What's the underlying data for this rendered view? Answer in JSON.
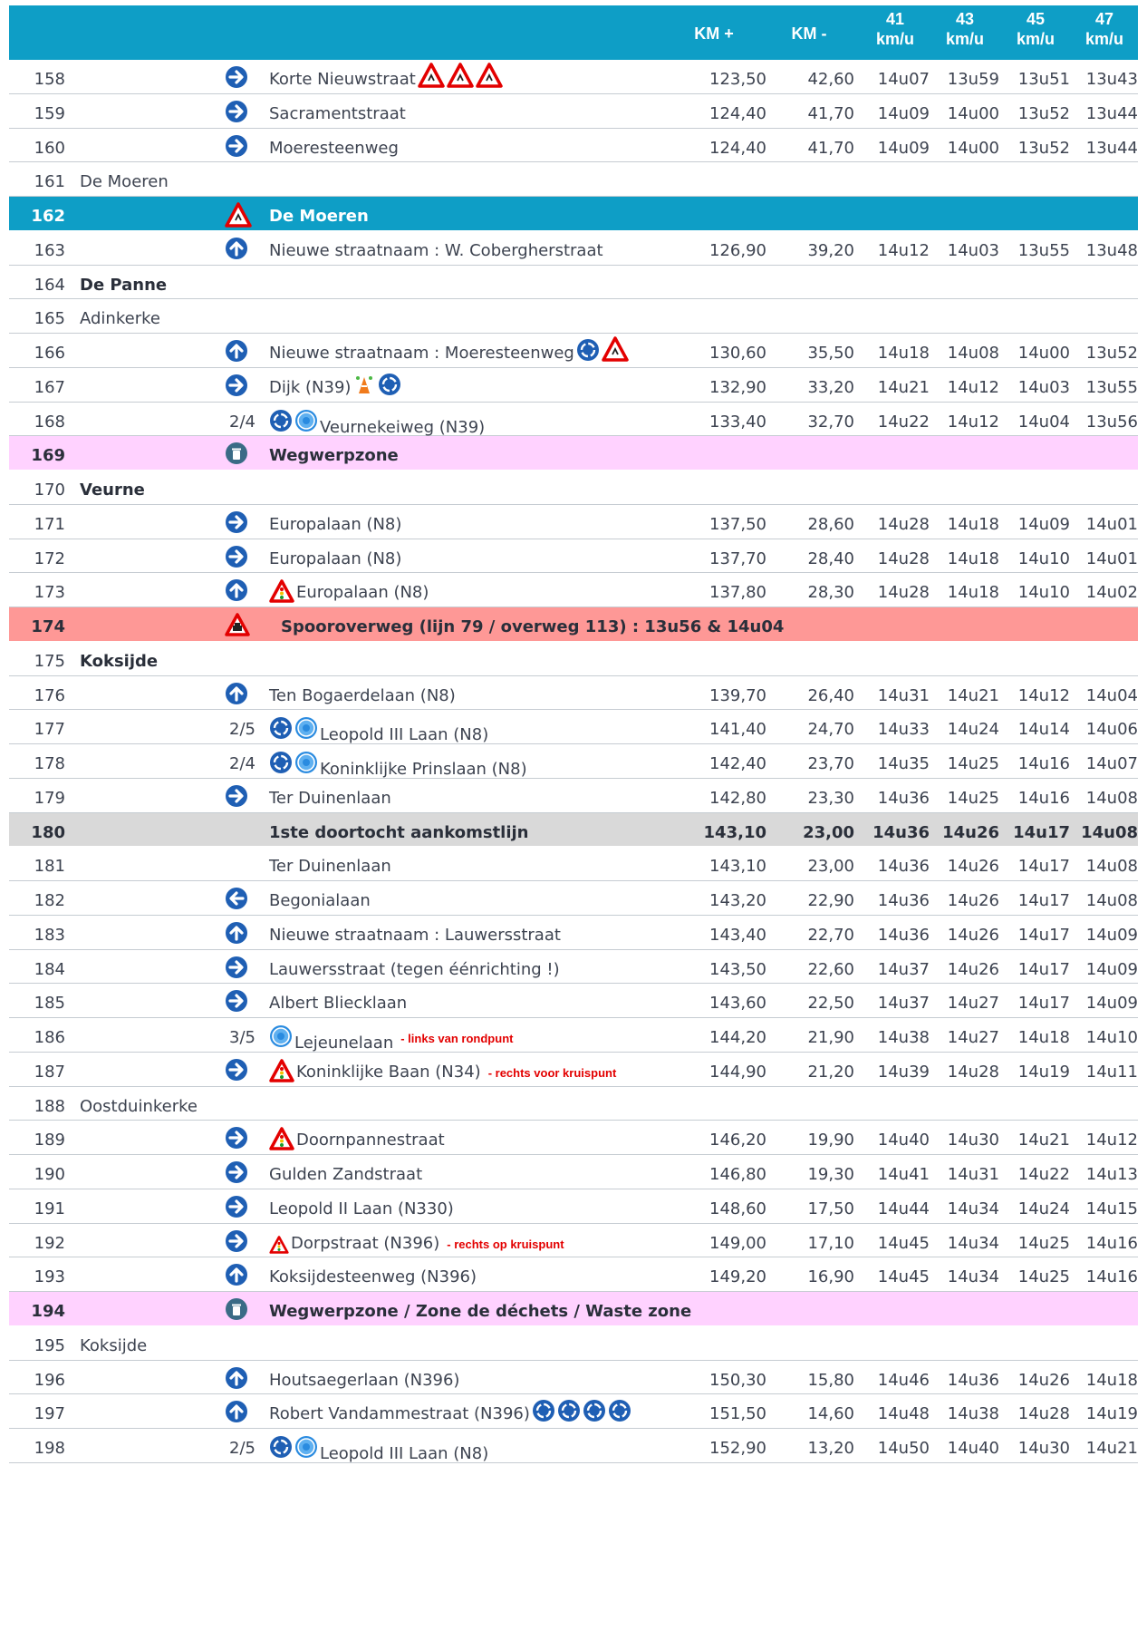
{
  "header": {
    "km_plus": "KM +",
    "km_minus": "KM -",
    "speeds": [
      {
        "top": "41",
        "bottom": "km/u"
      },
      {
        "top": "43",
        "bottom": "km/u"
      },
      {
        "top": "45",
        "bottom": "km/u"
      },
      {
        "top": "47",
        "bottom": "km/u"
      }
    ]
  },
  "colors": {
    "header": "#0e9ec6",
    "waste_zone": "#ffd2ff",
    "railway": "#fe9896",
    "finish": "#d9d9d9",
    "arrow": "#1f5fb4"
  },
  "rows": [
    {
      "num": "158",
      "kind": "route",
      "dir": "right",
      "street": "Korte Nieuwstraat",
      "signs": [
        "warning",
        "warning",
        "warning"
      ],
      "km_plus": "123,50",
      "km_minus": "42,60",
      "times": [
        "14u07",
        "13u59",
        "13u51",
        "13u43"
      ]
    },
    {
      "num": "159",
      "kind": "route",
      "dir": "right",
      "street": "Sacramentstraat",
      "km_plus": "124,40",
      "km_minus": "41,70",
      "times": [
        "14u09",
        "14u00",
        "13u52",
        "13u44"
      ]
    },
    {
      "num": "160",
      "kind": "route",
      "dir": "right",
      "street": "Moeresteenweg",
      "km_plus": "124,40",
      "km_minus": "41,70",
      "times": [
        "14u09",
        "14u00",
        "13u52",
        "13u44"
      ]
    },
    {
      "num": "161",
      "kind": "place",
      "place": "De Moeren"
    },
    {
      "num": "162",
      "kind": "highlight",
      "style": "blue",
      "dir": "warning",
      "street": "De Moeren"
    },
    {
      "num": "163",
      "kind": "route",
      "dir": "up",
      "street": "Nieuwe straatnaam : W. Cobergherstraat",
      "km_plus": "126,90",
      "km_minus": "39,20",
      "times": [
        "14u12",
        "14u03",
        "13u55",
        "13u48"
      ]
    },
    {
      "num": "164",
      "kind": "place",
      "bold": true,
      "place": "De Panne"
    },
    {
      "num": "165",
      "kind": "place",
      "place": "Adinkerke"
    },
    {
      "num": "166",
      "kind": "route",
      "dir": "up",
      "street": "Nieuwe straatnaam : Moeresteenweg",
      "signs": [
        "roundabout",
        "warning"
      ],
      "km_plus": "130,60",
      "km_minus": "35,50",
      "times": [
        "14u18",
        "14u08",
        "14u00",
        "13u52"
      ]
    },
    {
      "num": "167",
      "kind": "route",
      "dir": "right",
      "street": "Dijk (N39)",
      "signs": [
        "cones",
        "roundabout"
      ],
      "km_plus": "132,90",
      "km_minus": "33,20",
      "times": [
        "14u21",
        "14u12",
        "14u03",
        "13u55"
      ]
    },
    {
      "num": "168",
      "kind": "route",
      "frac": "2/4",
      "lead": [
        "roundabout",
        "roundabout-light"
      ],
      "street": "Veurnekeiweg (N39)",
      "km_plus": "133,40",
      "km_minus": "32,70",
      "times": [
        "14u22",
        "14u12",
        "14u04",
        "13u56"
      ]
    },
    {
      "num": "169",
      "kind": "highlight",
      "style": "pink",
      "dir": "bin",
      "street": "Wegwerpzone"
    },
    {
      "num": "170",
      "kind": "place",
      "bold": true,
      "place": "Veurne"
    },
    {
      "num": "171",
      "kind": "route",
      "dir": "right",
      "street": "Europalaan (N8)",
      "km_plus": "137,50",
      "km_minus": "28,60",
      "times": [
        "14u28",
        "14u18",
        "14u09",
        "14u01"
      ]
    },
    {
      "num": "172",
      "kind": "route",
      "dir": "right",
      "street": "Europalaan (N8)",
      "km_plus": "137,70",
      "km_minus": "28,40",
      "times": [
        "14u28",
        "14u18",
        "14u10",
        "14u01"
      ]
    },
    {
      "num": "173",
      "kind": "route",
      "dir": "up",
      "lead": [
        "signal"
      ],
      "street": "Europalaan (N8)",
      "km_plus": "137,80",
      "km_minus": "28,30",
      "times": [
        "14u28",
        "14u18",
        "14u10",
        "14u02"
      ]
    },
    {
      "num": "174",
      "kind": "highlight",
      "style": "red",
      "dir": "rail",
      "street": "Spooroverweg (lijn 79 / overweg 113) : 13u56 & 14u04"
    },
    {
      "num": "175",
      "kind": "place",
      "bold": true,
      "place": "Koksijde"
    },
    {
      "num": "176",
      "kind": "route",
      "dir": "up",
      "street": "Ten Bogaerdelaan (N8)",
      "km_plus": "139,70",
      "km_minus": "26,40",
      "times": [
        "14u31",
        "14u21",
        "14u12",
        "14u04"
      ]
    },
    {
      "num": "177",
      "kind": "route",
      "frac": "2/5",
      "lead": [
        "roundabout",
        "roundabout-light"
      ],
      "street": "Leopold III Laan (N8)",
      "km_plus": "141,40",
      "km_minus": "24,70",
      "times": [
        "14u33",
        "14u24",
        "14u14",
        "14u06"
      ]
    },
    {
      "num": "178",
      "kind": "route",
      "frac": "2/4",
      "lead": [
        "roundabout",
        "roundabout-light"
      ],
      "street": "Koninklijke Prinslaan (N8)",
      "km_plus": "142,40",
      "km_minus": "23,70",
      "times": [
        "14u35",
        "14u25",
        "14u16",
        "14u07"
      ]
    },
    {
      "num": "179",
      "kind": "route",
      "dir": "right",
      "street": "Ter Duinenlaan",
      "km_plus": "142,80",
      "km_minus": "23,30",
      "times": [
        "14u36",
        "14u25",
        "14u16",
        "14u08"
      ]
    },
    {
      "num": "180",
      "kind": "finish",
      "style": "grey",
      "street": "1ste  doortocht aankomstlijn",
      "km_plus": "143,10",
      "km_minus": "23,00",
      "times": [
        "14u36",
        "14u26",
        "14u17",
        "14u08"
      ]
    },
    {
      "num": "181",
      "kind": "route",
      "street": "Ter Duinenlaan",
      "km_plus": "143,10",
      "km_minus": "23,00",
      "times": [
        "14u36",
        "14u26",
        "14u17",
        "14u08"
      ]
    },
    {
      "num": "182",
      "kind": "route",
      "dir": "left",
      "street": "Begonialaan",
      "km_plus": "143,20",
      "km_minus": "22,90",
      "times": [
        "14u36",
        "14u26",
        "14u17",
        "14u08"
      ]
    },
    {
      "num": "183",
      "kind": "route",
      "dir": "up",
      "street": "Nieuwe straatnaam : Lauwersstraat",
      "km_plus": "143,40",
      "km_minus": "22,70",
      "times": [
        "14u36",
        "14u26",
        "14u17",
        "14u09"
      ]
    },
    {
      "num": "184",
      "kind": "route",
      "dir": "right",
      "street": "Lauwersstraat (tegen éénrichting !)",
      "km_plus": "143,50",
      "km_minus": "22,60",
      "times": [
        "14u37",
        "14u26",
        "14u17",
        "14u09"
      ]
    },
    {
      "num": "185",
      "kind": "route",
      "dir": "right",
      "street": "Albert Bliecklaan",
      "km_plus": "143,60",
      "km_minus": "22,50",
      "times": [
        "14u37",
        "14u27",
        "14u17",
        "14u09"
      ]
    },
    {
      "num": "186",
      "kind": "route",
      "frac": "3/5",
      "lead": [
        "roundabout-light"
      ],
      "street": "Lejeunelaan",
      "note": "- links van rondpunt",
      "km_plus": "144,20",
      "km_minus": "21,90",
      "times": [
        "14u38",
        "14u27",
        "14u18",
        "14u10"
      ]
    },
    {
      "num": "187",
      "kind": "route",
      "dir": "right",
      "lead": [
        "signal"
      ],
      "street": "Koninklijke Baan (N34)",
      "note": "- rechts voor kruispunt",
      "km_plus": "144,90",
      "km_minus": "21,20",
      "times": [
        "14u39",
        "14u28",
        "14u19",
        "14u11"
      ]
    },
    {
      "num": "188",
      "kind": "place",
      "place": "Oostduinkerke"
    },
    {
      "num": "189",
      "kind": "route",
      "dir": "right",
      "lead": [
        "signal"
      ],
      "street": "Doornpannestraat",
      "km_plus": "146,20",
      "km_minus": "19,90",
      "times": [
        "14u40",
        "14u30",
        "14u21",
        "14u12"
      ]
    },
    {
      "num": "190",
      "kind": "route",
      "dir": "right",
      "street": "Gulden Zandstraat",
      "km_plus": "146,80",
      "km_minus": "19,30",
      "times": [
        "14u41",
        "14u31",
        "14u22",
        "14u13"
      ]
    },
    {
      "num": "191",
      "kind": "route",
      "dir": "right",
      "street": "Leopold II Laan (N330)",
      "km_plus": "148,60",
      "km_minus": "17,50",
      "times": [
        "14u44",
        "14u34",
        "14u24",
        "14u15"
      ]
    },
    {
      "num": "192",
      "kind": "route",
      "dir": "right",
      "lead": [
        "signal-small"
      ],
      "street": "Dorpstraat (N396)",
      "note": "- rechts op kruispunt",
      "km_plus": "149,00",
      "km_minus": "17,10",
      "times": [
        "14u45",
        "14u34",
        "14u25",
        "14u16"
      ]
    },
    {
      "num": "193",
      "kind": "route",
      "dir": "up",
      "street": "Koksijdesteenweg (N396)",
      "km_plus": "149,20",
      "km_minus": "16,90",
      "times": [
        "14u45",
        "14u34",
        "14u25",
        "14u16"
      ]
    },
    {
      "num": "194",
      "kind": "highlight",
      "style": "pink",
      "dir": "bin",
      "street": "Wegwerpzone / Zone de déchets / Waste  zone"
    },
    {
      "num": "195",
      "kind": "place",
      "place": "Koksijde"
    },
    {
      "num": "196",
      "kind": "route",
      "dir": "up",
      "street": "Houtsaegerlaan (N396)",
      "km_plus": "150,30",
      "km_minus": "15,80",
      "times": [
        "14u46",
        "14u36",
        "14u26",
        "14u18"
      ]
    },
    {
      "num": "197",
      "kind": "route",
      "dir": "up",
      "street": "Robert Vandammestraat (N396)",
      "signs": [
        "roundabout",
        "roundabout",
        "roundabout",
        "roundabout"
      ],
      "km_plus": "151,50",
      "km_minus": "14,60",
      "times": [
        "14u48",
        "14u38",
        "14u28",
        "14u19"
      ]
    },
    {
      "num": "198",
      "kind": "route",
      "frac": "2/5",
      "lead": [
        "roundabout",
        "roundabout-light"
      ],
      "street": "Leopold III Laan (N8)",
      "km_plus": "152,90",
      "km_minus": "13,20",
      "times": [
        "14u50",
        "14u40",
        "14u30",
        "14u21"
      ]
    }
  ]
}
